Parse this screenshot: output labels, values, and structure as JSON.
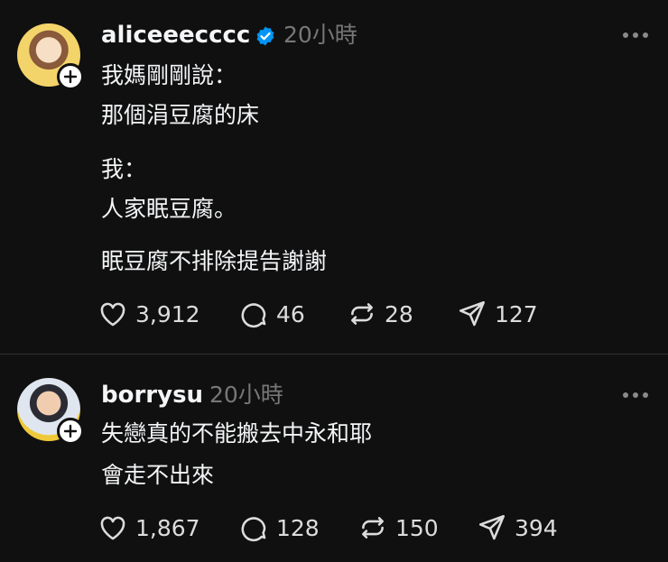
{
  "posts": [
    {
      "username": "aliceeecccc",
      "verified": true,
      "time": "20小時",
      "lines": [
        "我媽剛剛說：",
        "那個涓豆腐的床",
        "我：",
        "人家眠豆腐。",
        "眠豆腐不排除提告謝謝"
      ],
      "likes": "3,912",
      "replies": "46",
      "reposts": "28",
      "shares": "127"
    },
    {
      "username": "borrysu",
      "verified": false,
      "time": "20小時",
      "lines": [
        "失戀真的不能搬去中永和耶",
        "會走不出來"
      ],
      "likes": "1,867",
      "replies": "128",
      "reposts": "150",
      "shares": "394"
    }
  ],
  "icons": {
    "like": "heart-icon",
    "reply": "comment-icon",
    "repost": "repost-icon",
    "share": "share-icon",
    "more": "more-icon",
    "follow": "plus-icon",
    "verified": "verified-badge-icon"
  },
  "colors": {
    "background": "#101010",
    "text": "#f3f5f7",
    "muted": "#777777",
    "verified": "#0095f6"
  }
}
